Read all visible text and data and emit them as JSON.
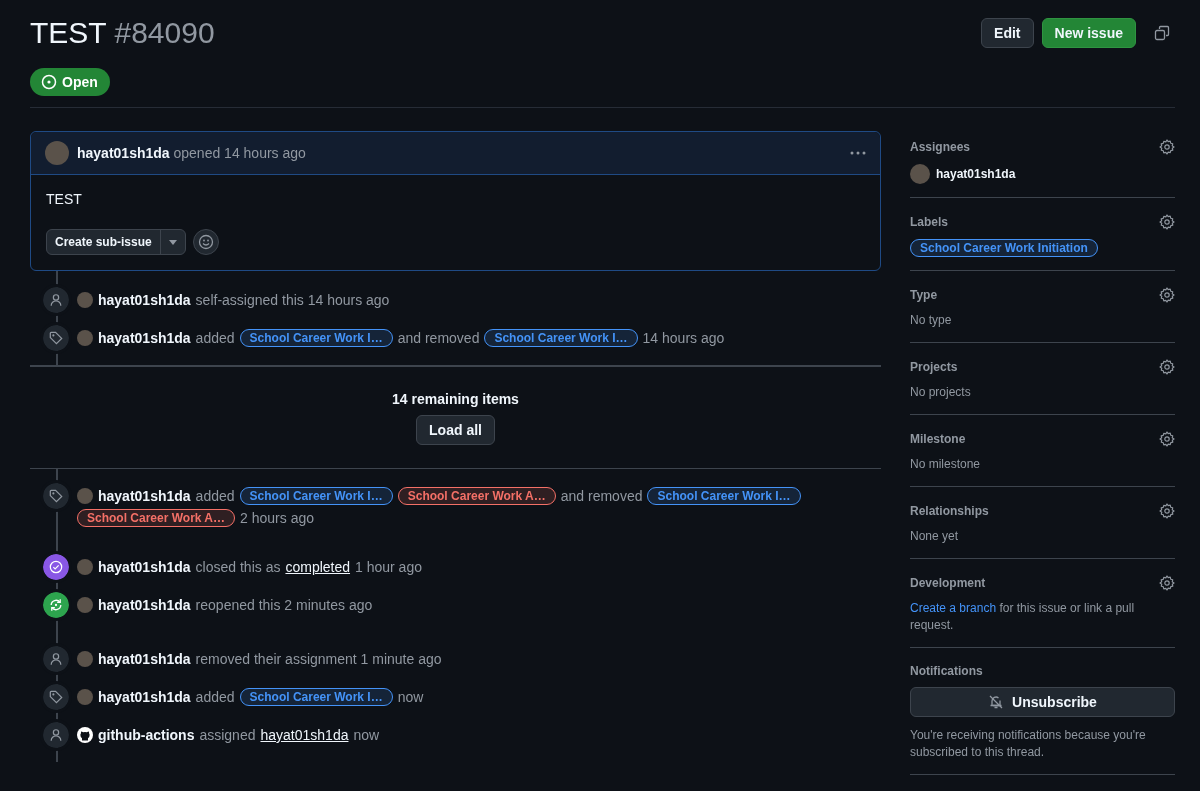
{
  "header": {
    "title": "TEST",
    "number": "#84090",
    "state": "Open",
    "buttons": [
      "Edit",
      "New issue"
    ]
  },
  "comment": {
    "author": "hayat01sh1da",
    "meta": "opened 14 hours ago",
    "body": "TEST",
    "sub_issue_button": "Create sub-issue"
  },
  "timeline_before": [
    {
      "kind": "person",
      "actor": {
        "kind": "user",
        "name": "hayat01sh1da"
      },
      "parts": [
        {
          "kind": "text",
          "text": "self-assigned this 14 hours ago"
        }
      ]
    },
    {
      "kind": "tag",
      "actor": {
        "kind": "user",
        "name": "hayat01sh1da"
      },
      "parts": [
        {
          "kind": "text",
          "text": "added"
        },
        {
          "kind": "label",
          "text": "School Career Work I…",
          "color": "#4493f8"
        },
        {
          "kind": "text",
          "text": "and removed"
        },
        {
          "kind": "label",
          "text": "School Career Work I…",
          "color": "#4493f8"
        },
        {
          "kind": "text",
          "text": "14 hours ago"
        }
      ]
    }
  ],
  "load_more": {
    "count": "14 remaining items",
    "button": "Load all"
  },
  "timeline_after": [
    {
      "kind": "tag",
      "actor": {
        "kind": "user",
        "name": "hayat01sh1da"
      },
      "parts": [
        {
          "kind": "text",
          "text": "added"
        },
        {
          "kind": "label",
          "text": "School Career Work I…",
          "color": "#4493f8"
        },
        {
          "kind": "label",
          "text": "School Career Work A…",
          "color": "#f47067"
        },
        {
          "kind": "text",
          "text": "and removed"
        },
        {
          "kind": "label",
          "text": "School Career Work I…",
          "color": "#4493f8"
        },
        {
          "kind": "label",
          "text": "School Career Work A…",
          "color": "#f47067"
        },
        {
          "kind": "text",
          "text": "2 hours ago"
        }
      ]
    },
    {
      "kind": "closed",
      "actor": {
        "kind": "user",
        "name": "hayat01sh1da"
      },
      "parts": [
        {
          "kind": "text",
          "text": "closed this as"
        },
        {
          "kind": "link",
          "text": "completed"
        },
        {
          "kind": "text",
          "text": "1 hour ago"
        }
      ]
    },
    {
      "kind": "reopened",
      "actor": {
        "kind": "user",
        "name": "hayat01sh1da"
      },
      "parts": [
        {
          "kind": "text",
          "text": "reopened this 2 minutes ago"
        }
      ]
    },
    {
      "kind": "person",
      "actor": {
        "kind": "user",
        "name": "hayat01sh1da"
      },
      "parts": [
        {
          "kind": "text",
          "text": "removed their assignment 1 minute ago"
        }
      ]
    },
    {
      "kind": "tag",
      "actor": {
        "kind": "user",
        "name": "hayat01sh1da"
      },
      "parts": [
        {
          "kind": "text",
          "text": "added"
        },
        {
          "kind": "label",
          "text": "School Career Work I…",
          "color": "#4493f8"
        },
        {
          "kind": "text",
          "text": "now"
        }
      ]
    },
    {
      "kind": "person",
      "actor": {
        "kind": "bot",
        "name": "github-actions"
      },
      "parts": [
        {
          "kind": "text",
          "text": "assigned"
        },
        {
          "kind": "link",
          "text": "hayat01sh1da"
        },
        {
          "kind": "text",
          "text": "now"
        }
      ]
    }
  ],
  "sidebar": [
    {
      "kind": "assignee",
      "heading": "Assignees",
      "value": "hayat01sh1da"
    },
    {
      "kind": "label",
      "heading": "Labels",
      "value": "School Career Work Initiation",
      "color": "#4493f8"
    },
    {
      "kind": "text",
      "heading": "Type",
      "value": "No type"
    },
    {
      "kind": "text",
      "heading": "Projects",
      "value": "No projects"
    },
    {
      "kind": "text",
      "heading": "Milestone",
      "value": "No milestone"
    },
    {
      "kind": "text",
      "heading": "Relationships",
      "value": "None yet"
    },
    {
      "kind": "development",
      "heading": "Development",
      "link": "Create a branch",
      "value": "for this issue or link a pull request."
    },
    {
      "kind": "notifications",
      "heading": "Notifications",
      "button": "Unsubscribe",
      "value": "You're receiving notifications because you're subscribed to this thread."
    }
  ]
}
